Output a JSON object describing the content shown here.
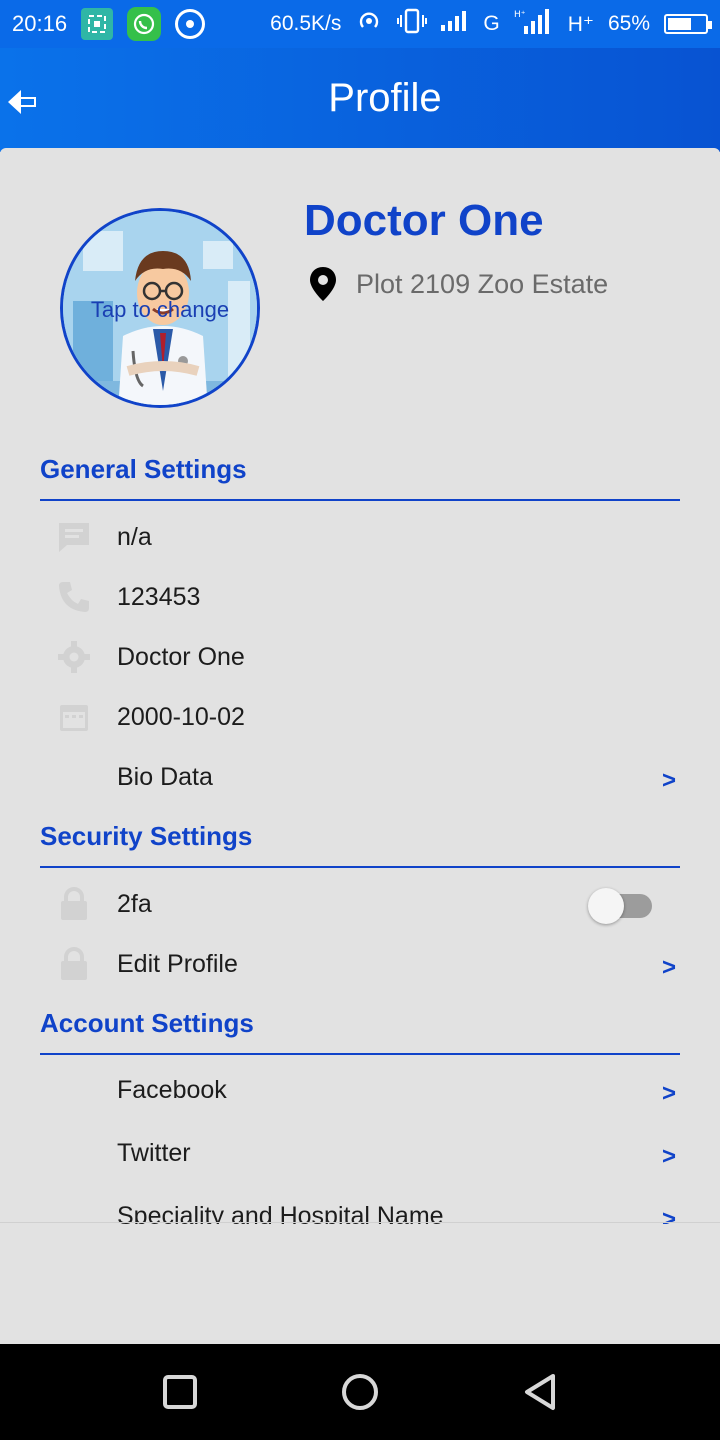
{
  "status_bar": {
    "time": "20:16",
    "speed": "60.5K/s",
    "net1": "G",
    "net2": "H⁺",
    "battery": "65%",
    "battery_level": 0.65
  },
  "app_bar": {
    "title": "Profile"
  },
  "profile": {
    "name": "Doctor One",
    "address": "Plot 2109 Zoo Estate",
    "avatar_hint": "Tap to change"
  },
  "sections": {
    "general": {
      "title": "General Settings",
      "items": [
        {
          "label": "n/a",
          "icon": "message-icon"
        },
        {
          "label": "123453",
          "icon": "phone-icon"
        },
        {
          "label": "Doctor One",
          "icon": "gear-icon"
        },
        {
          "label": "2000-10-02",
          "icon": "calendar-icon"
        },
        {
          "label": "Bio Data",
          "chevron": ">"
        }
      ]
    },
    "security": {
      "title": "Security Settings",
      "items": [
        {
          "label": "2fa",
          "icon": "lock-icon",
          "toggle_on": false
        },
        {
          "label": "Edit Profile",
          "icon": "lock-icon",
          "chevron": ">"
        }
      ]
    },
    "account": {
      "title": "Account Settings",
      "items": [
        {
          "label": "Facebook",
          "chevron": ">"
        },
        {
          "label": "Twitter",
          "chevron": ">"
        },
        {
          "label": "Speciality and Hospital Name",
          "chevron": ">"
        }
      ]
    }
  },
  "colors": {
    "accent": "#1043c9",
    "appbar_start": "#0a72ea",
    "appbar_end": "#0853d2",
    "background": "#e2e2e2",
    "icon_muted": "#d2d2d2"
  }
}
